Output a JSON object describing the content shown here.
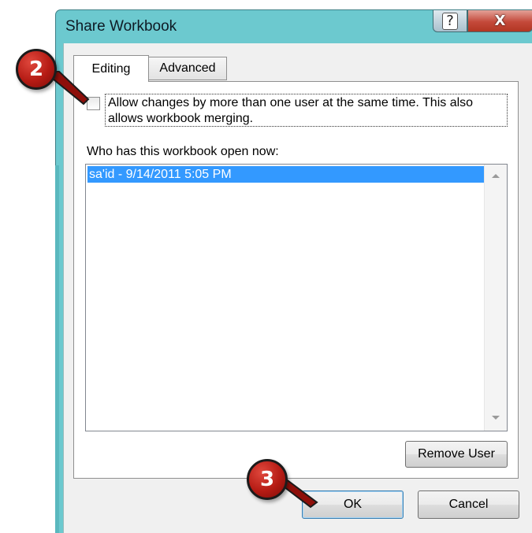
{
  "window": {
    "title": "Share Workbook",
    "help_glyph": "?",
    "close_glyph": "X"
  },
  "tabs": [
    {
      "label": "Editing",
      "active": true
    },
    {
      "label": "Advanced",
      "active": false
    }
  ],
  "editing": {
    "allow_changes_label": "Allow changes by more than one user at the same time.  This also allows workbook merging.",
    "allow_changes_checked": false,
    "who_label": "Who has this workbook open now:",
    "users": [
      "sa'id - 9/14/2011 5:05 PM"
    ]
  },
  "buttons": {
    "remove_user": "Remove User",
    "ok": "OK",
    "cancel": "Cancel"
  },
  "callouts": {
    "step_2": "2",
    "step_3": "3"
  },
  "colors": {
    "title_bar": "#6cc9cf",
    "selection": "#3399ff",
    "callout": "#b51b14"
  }
}
